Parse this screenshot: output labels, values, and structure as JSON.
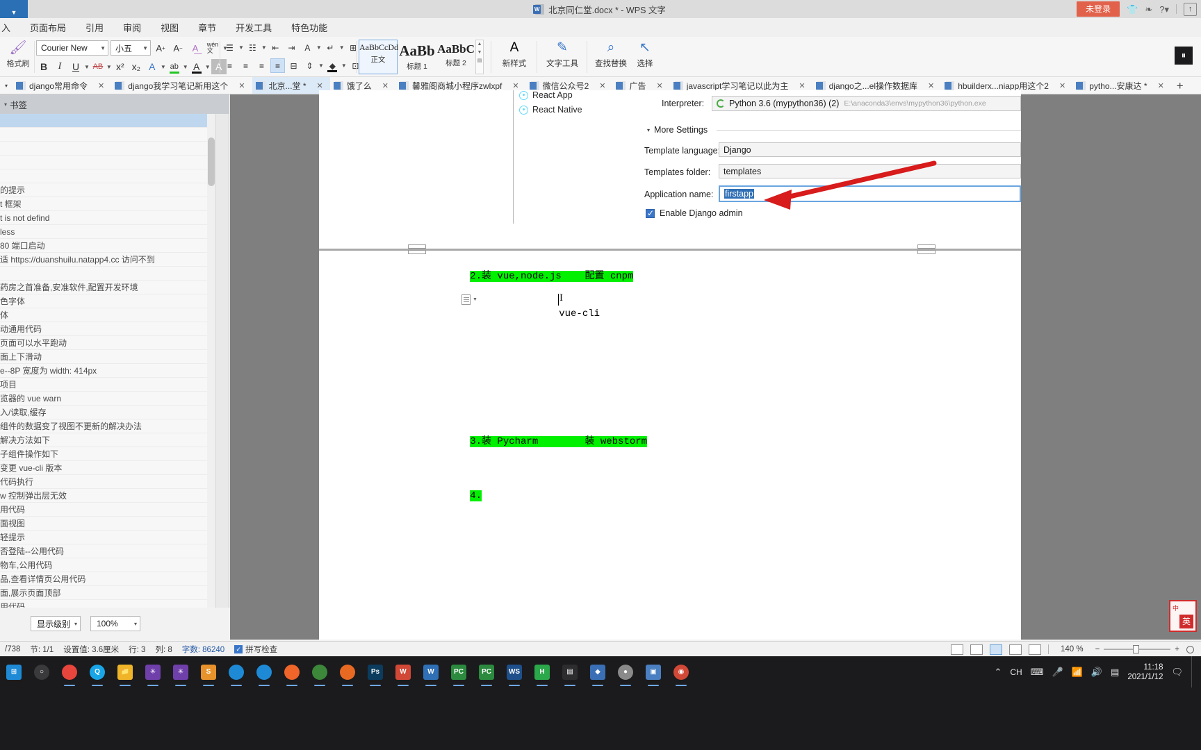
{
  "titlebar": {
    "doc_title": "北京同仁堂.docx * - WPS 文字",
    "login_label": "未登录",
    "icons": [
      "shirt-icon",
      "wechat-icon",
      "help-icon",
      "upload-icon"
    ],
    "help_label": "?",
    "upload_label": "↑"
  },
  "menu": {
    "items": [
      "入",
      "页面布局",
      "引用",
      "审阅",
      "视图",
      "章节",
      "开发工具",
      "特色功能"
    ]
  },
  "ribbon": {
    "format_painter": "格式刷",
    "font_name": "Courier New",
    "font_size": "小五",
    "grow_font": "A",
    "shrink_font": "A",
    "clear_format": "A",
    "pinyin": "wén",
    "bold": "B",
    "italic": "I",
    "underline": "U",
    "strikethrough": "AB",
    "superscript": "x²",
    "subscript": "x₂",
    "char_border": "A",
    "highlight": "ab",
    "font_color": "A",
    "char_shading": "A",
    "bullets": "☰",
    "numbering": "☷",
    "dec_indent": "⇤",
    "inc_indent": "⇥",
    "asian_layout": "A",
    "line_spacing": "↵",
    "borders_table": "⊞",
    "align_left": "≡",
    "align_center": "≡",
    "align_right": "≡",
    "align_justify": "≡",
    "distribute": "⊟",
    "line_spacing2": "⇕",
    "shading": "◆",
    "borders": "⊡",
    "styles": [
      {
        "preview": "AaBbCcDd",
        "label": "正文",
        "selected": true
      },
      {
        "preview": "AaBb",
        "label": "标题 1",
        "selected": false
      },
      {
        "preview": "AaBbC",
        "label": "标题 2",
        "selected": false
      }
    ],
    "new_style_label": "新样式",
    "new_style_icon": "A",
    "text_tools_label": "文字工具",
    "text_tools_icon": "✎",
    "find_replace_label": "查找替换",
    "find_replace_icon": "⌕",
    "select_label": "选择",
    "select_icon": "↖",
    "pause_icon": "⏸"
  },
  "tabs": {
    "caret": "▾",
    "plus": "+",
    "close": "✕",
    "items": [
      {
        "label": "django常用命令",
        "active": false
      },
      {
        "label": "django我学习笔记新用这个",
        "active": false
      },
      {
        "label": "北京...堂 *",
        "active": true
      },
      {
        "label": "饿了么",
        "active": false
      },
      {
        "label": "馨雅阁商城小程序zwlxpf",
        "active": false
      },
      {
        "label": "微信公众号2",
        "active": false
      },
      {
        "label": "广告",
        "active": false
      },
      {
        "label": "javascript学习笔记以此为主",
        "active": false
      },
      {
        "label": "django之...el操作数据库",
        "active": false
      },
      {
        "label": "hbuilderx...niapp用这个2",
        "active": false
      },
      {
        "label": "pytho...安康达 *",
        "active": false
      }
    ]
  },
  "navpane": {
    "header_title": "书签",
    "header_caret": "▾",
    "items": [
      {
        "label": "",
        "selected": true
      },
      {
        "label": "",
        "selected": false
      },
      {
        "label": "",
        "selected": false
      },
      {
        "label": "",
        "selected": false
      },
      {
        "label": "",
        "selected": false
      },
      {
        "label": "的提示",
        "selected": false
      },
      {
        "label": "t 框架",
        "selected": false
      },
      {
        "label": "t is not defind",
        "selected": false
      },
      {
        "label": " less",
        "selected": false
      },
      {
        "label": " 80 端口启动",
        "selected": false
      },
      {
        "label": "适 https://duanshuilu.natapp4.cc 访问不到",
        "selected": false
      },
      {
        "label": "",
        "selected": false
      },
      {
        "label": "药房之首准备,安准软件,配置开发环境",
        "selected": false
      },
      {
        "label": "色字体",
        "selected": false
      },
      {
        "label": "体",
        "selected": false
      },
      {
        "label": "动通用代码",
        "selected": false
      },
      {
        "label": "页面可以水平跑动",
        "selected": false
      },
      {
        "label": "面上下滑动",
        "selected": false
      },
      {
        "label": "e--8P 宽度为 width: 414px",
        "selected": false
      },
      {
        "label": "项目",
        "selected": false
      },
      {
        "label": "览器的 vue warn",
        "selected": false
      },
      {
        "label": "入/读取,缓存",
        "selected": false
      },
      {
        "label": "组件的数据变了视图不更新的解决办法",
        "selected": false
      },
      {
        "label": "解决方法如下",
        "selected": false
      },
      {
        "label": "子组件操作如下",
        "selected": false
      },
      {
        "label": "变更 vue-cli 版本",
        "selected": false
      },
      {
        "label": "代码执行",
        "selected": false
      },
      {
        "label": "w 控制弹出层无效",
        "selected": false
      },
      {
        "label": "用代码",
        "selected": false
      },
      {
        "label": "面视图",
        "selected": false
      },
      {
        "label": "轻提示",
        "selected": false
      },
      {
        "label": "否登陆--公用代码",
        "selected": false
      },
      {
        "label": "物车,公用代码",
        "selected": false
      },
      {
        "label": "品,查看详情页公用代码",
        "selected": false
      },
      {
        "label": "面,展示页面顶部",
        "selected": false
      },
      {
        "label": "用代码",
        "selected": false
      }
    ],
    "footer": {
      "level_label": "显示级别",
      "zoom_label": "100%",
      "caret": "▾"
    }
  },
  "document": {
    "screenshot": {
      "tree_items": [
        {
          "label": "React App",
          "icon": "react-icon"
        },
        {
          "label": "React Native",
          "icon": "react-icon"
        }
      ],
      "interpreter_label": "Interpreter:",
      "interpreter_value": "Python 3.6 (mypython36) (2)",
      "interpreter_path": "E:\\anaconda3\\envs\\mypython36\\python.exe",
      "more_settings_label": "More Settings",
      "more_settings_caret": "▾",
      "template_language_label": "Template language:",
      "template_language_value": "Django",
      "templates_folder_label": "Templates folder:",
      "templates_folder_value": "templates",
      "application_name_label": "Application name:",
      "application_name_value": "firstapp",
      "enable_admin_label": "Enable Django admin",
      "annotation": "red-arrow-pointing-at-application-name"
    },
    "lines": [
      {
        "text": "2.装 vue,node.js    配置 cnpm",
        "highlight": true
      },
      {
        "text": "vue-cli",
        "highlight": false
      },
      {
        "text": "3.装 Pycharm        装 webstorm",
        "highlight": true
      },
      {
        "text": "4.",
        "highlight": true
      }
    ],
    "highlight_color": "#00f000"
  },
  "statusbar": {
    "left_items": [
      "/738",
      "节: 1/1",
      "设置值: 3.6厘米",
      "行: 3",
      "列: 8",
      "字数: 86240"
    ],
    "word_count_value": "字数: 86240",
    "spellcheck": "拼写检查",
    "zoom_level": "140 %",
    "zoom_minus": "−",
    "zoom_plus": "+",
    "view_buttons": [
      "page-view",
      "outline-view",
      "web-view",
      "read-view",
      "print-view"
    ]
  },
  "ime_badge": {
    "top_text": "中",
    "square_text": "英"
  },
  "taskbar": {
    "start_icon": "windows-start-icon",
    "apps": [
      {
        "name": "start-button",
        "glyph": "⊞",
        "color": "#1e8ad6",
        "shape": "grid",
        "running": false
      },
      {
        "name": "search-button",
        "glyph": "○",
        "color": "#3a3a3c",
        "shape": "circle",
        "running": false
      },
      {
        "name": "chrome",
        "glyph": "",
        "color": "#e8453c",
        "shape": "circle",
        "running": true
      },
      {
        "name": "qq-browser",
        "glyph": "Q",
        "color": "#19a6e8",
        "shape": "circle",
        "running": true
      },
      {
        "name": "file-explorer",
        "glyph": "📁",
        "color": "#f0b429",
        "shape": "sq",
        "running": true
      },
      {
        "name": "visual-studio",
        "glyph": "✳",
        "color": "#6f3faa",
        "shape": "sq",
        "running": true
      },
      {
        "name": "visual-studio-2",
        "glyph": "✳",
        "color": "#6f3faa",
        "shape": "sq",
        "running": true
      },
      {
        "name": "sublime",
        "glyph": "S",
        "color": "#e8922c",
        "shape": "sq",
        "running": true
      },
      {
        "name": "browser-1",
        "glyph": "",
        "color": "#1e8ad6",
        "shape": "circle",
        "running": true
      },
      {
        "name": "browser-2",
        "glyph": "",
        "color": "#1e8ad6",
        "shape": "circle",
        "running": true
      },
      {
        "name": "postman",
        "glyph": "",
        "color": "#f06529",
        "shape": "circle",
        "running": true
      },
      {
        "name": "node",
        "glyph": "",
        "color": "#3c873a",
        "shape": "circle",
        "running": true
      },
      {
        "name": "firefox",
        "glyph": "",
        "color": "#e86a22",
        "shape": "circle",
        "running": true
      },
      {
        "name": "photoshop",
        "glyph": "Ps",
        "color": "#0b3c5d",
        "shape": "sq",
        "running": true
      },
      {
        "name": "wps",
        "glyph": "W",
        "color": "#d14836",
        "shape": "sq",
        "running": true
      },
      {
        "name": "wps-writer",
        "glyph": "W",
        "color": "#2f6fb5",
        "shape": "sq",
        "running": true
      },
      {
        "name": "pycharm",
        "glyph": "PC",
        "color": "#2b8a3e",
        "shape": "sq",
        "running": true
      },
      {
        "name": "pycharm-2",
        "glyph": "PC",
        "color": "#2b8a3e",
        "shape": "sq",
        "running": true
      },
      {
        "name": "webstorm",
        "glyph": "WS",
        "color": "#1e4f8a",
        "shape": "sq",
        "running": true
      },
      {
        "name": "hbuilder",
        "glyph": "H",
        "color": "#2aa84a",
        "shape": "sq",
        "running": true
      },
      {
        "name": "terminal",
        "glyph": "▤",
        "color": "#2d2d30",
        "shape": "sq",
        "running": true
      },
      {
        "name": "app-22",
        "glyph": "◆",
        "color": "#3a6fb5",
        "shape": "sq",
        "running": true
      },
      {
        "name": "app-23",
        "glyph": "●",
        "color": "#8a8a8a",
        "shape": "circle",
        "running": true
      },
      {
        "name": "app-24",
        "glyph": "▣",
        "color": "#4a7fc1",
        "shape": "sq",
        "running": true
      },
      {
        "name": "app-25",
        "glyph": "◉",
        "color": "#d14836",
        "shape": "circle",
        "running": true
      }
    ],
    "tray": {
      "time": "11:18",
      "date": "2021/1/12",
      "ime": "CH",
      "icons": [
        "chevron-up-icon",
        "network-icon",
        "volume-icon",
        "battery-icon",
        "notification-icon"
      ]
    }
  }
}
